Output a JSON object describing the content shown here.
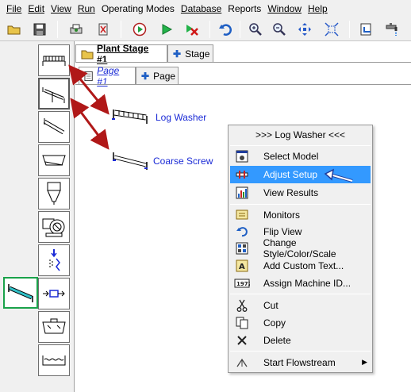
{
  "menubar": {
    "items": [
      "File",
      "Edit",
      "View",
      "Run",
      "Operating Modes",
      "Database",
      "Reports",
      "Window",
      "Help"
    ]
  },
  "toolbar": {
    "icons": [
      "open-folder-icon",
      "save-disk-icon",
      "print-icon",
      "delete-icon",
      "record-icon",
      "run-icon",
      "stop-icon",
      "undo-icon",
      "zoom-in-icon",
      "zoom-out-icon",
      "pan-icon",
      "fit-icon",
      "export-icon",
      "faucet-icon"
    ]
  },
  "tabs": {
    "stage_active": "Plant Stage #1",
    "stage_add": "Stage",
    "page_active": "Page #1",
    "page_add": "Page"
  },
  "canvas": {
    "log_washer_label": "Log Washer",
    "coarse_screw_label": "Coarse Screw"
  },
  "context_menu": {
    "header": ">>> Log Washer <<<",
    "items": [
      {
        "label": "Select Model",
        "icon": "select-model-icon"
      },
      {
        "label": "Adjust Setup",
        "icon": "adjust-setup-icon"
      },
      {
        "label": "View Results",
        "icon": "view-results-icon"
      },
      {
        "label": "Monitors",
        "icon": "monitors-icon"
      },
      {
        "label": "Flip View",
        "icon": "flip-view-icon"
      },
      {
        "label": "Change Style/Color/Scale",
        "icon": "change-style-icon"
      },
      {
        "label": "Add Custom Text...",
        "icon": "custom-text-icon"
      },
      {
        "label": "Assign Machine ID...",
        "icon": "machine-id-icon"
      },
      {
        "label": "Cut",
        "icon": "cut-icon"
      },
      {
        "label": "Copy",
        "icon": "copy-icon"
      },
      {
        "label": "Delete",
        "icon": "delete-x-icon"
      },
      {
        "label": "Start Flowstream",
        "icon": "flowstream-icon"
      }
    ]
  },
  "colors": {
    "accent_highlight": "#3399ff",
    "label_blue": "#1b2bd6",
    "arrow_red": "#b01818",
    "active_palette_border": "#1aa24a"
  }
}
